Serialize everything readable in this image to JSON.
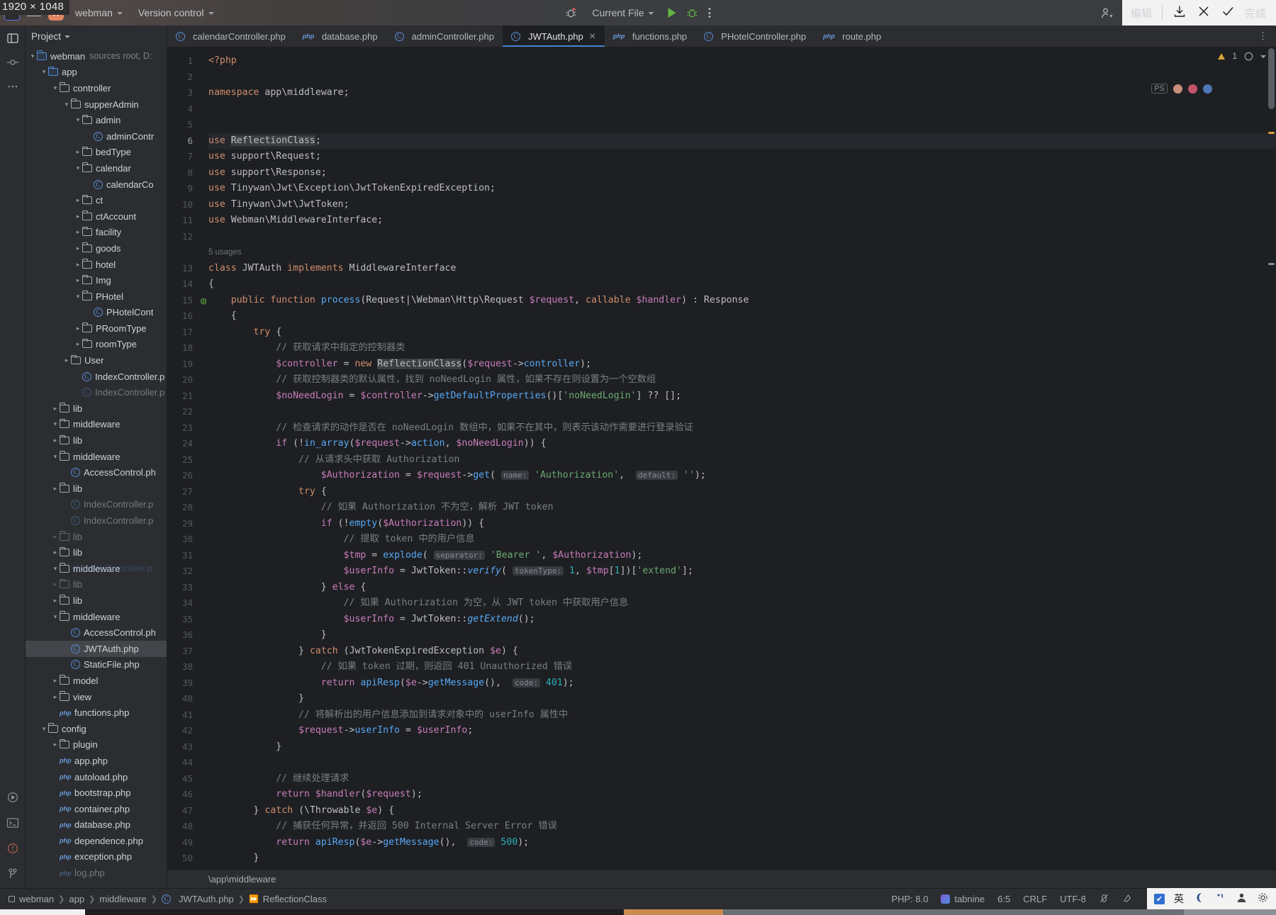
{
  "overlay": {
    "dimension_badge": "1920 × 1048",
    "screenshot_tool": {
      "edit_label": "编辑",
      "save_icon": "download-icon",
      "close_icon": "close-icon",
      "done_label": "完成"
    }
  },
  "titlebar": {
    "ps_icon": "phpstorm-icon",
    "menu_icon": "hamburger-menu-icon",
    "project_badge": "W",
    "project_name": "webman",
    "version_control": "Version control",
    "debug_error_icon": "debug-error-icon",
    "run_config": "Current File",
    "run_icon": "run-icon",
    "debug_icon": "debug-icon",
    "more_icon": "more-options-icon",
    "share_icon": "add-user-icon",
    "search_icon": "search-icon",
    "settings_icon": "gear-icon"
  },
  "rail": {
    "top": [
      {
        "name": "project-tool-icon",
        "glyph": "▣"
      },
      {
        "name": "commit-tool-icon",
        "glyph": "⎇"
      },
      {
        "name": "more-tool-icon",
        "glyph": "⋯"
      }
    ],
    "right": [
      {
        "name": "notifications-icon",
        "glyph": "🔔"
      },
      {
        "name": "ai-assistant-icon",
        "glyph": "✳"
      },
      {
        "name": "database-icon",
        "glyph": "⛁"
      },
      {
        "name": "gradle-icon",
        "glyph": "✿"
      },
      {
        "name": "plugin-icon",
        "glyph": "✡"
      }
    ],
    "bottom": [
      {
        "name": "run-tool-icon",
        "glyph": "▷"
      },
      {
        "name": "terminal-icon",
        "glyph": "⌨"
      },
      {
        "name": "problems-icon",
        "glyph": "⚠"
      },
      {
        "name": "vcs-branch-icon",
        "glyph": "⑂"
      }
    ]
  },
  "project_panel": {
    "title": "Project",
    "tree": [
      {
        "depth": 0,
        "arrow": "down",
        "icon": "folder-blue",
        "label": "webman",
        "suffix": "sources root, D:"
      },
      {
        "depth": 1,
        "arrow": "down",
        "icon": "folder-blue",
        "label": "app"
      },
      {
        "depth": 2,
        "arrow": "down",
        "icon": "folder",
        "label": "controller"
      },
      {
        "depth": 3,
        "arrow": "down",
        "icon": "folder",
        "label": "supperAdmin"
      },
      {
        "depth": 4,
        "arrow": "down",
        "icon": "folder",
        "label": "admin"
      },
      {
        "depth": 5,
        "arrow": "none",
        "icon": "class",
        "label": "adminContr"
      },
      {
        "depth": 4,
        "arrow": "right",
        "icon": "folder",
        "label": "bedType"
      },
      {
        "depth": 4,
        "arrow": "down",
        "icon": "folder",
        "label": "calendar"
      },
      {
        "depth": 5,
        "arrow": "none",
        "icon": "class",
        "label": "calendarCo"
      },
      {
        "depth": 4,
        "arrow": "right",
        "icon": "folder",
        "label": "ct"
      },
      {
        "depth": 4,
        "arrow": "right",
        "icon": "folder",
        "label": "ctAccount"
      },
      {
        "depth": 4,
        "arrow": "right",
        "icon": "folder",
        "label": "facility"
      },
      {
        "depth": 4,
        "arrow": "right",
        "icon": "folder",
        "label": "goods"
      },
      {
        "depth": 4,
        "arrow": "right",
        "icon": "folder",
        "label": "hotel"
      },
      {
        "depth": 4,
        "arrow": "right",
        "icon": "folder",
        "label": "Img"
      },
      {
        "depth": 4,
        "arrow": "down",
        "icon": "folder",
        "label": "PHotel"
      },
      {
        "depth": 5,
        "arrow": "none",
        "icon": "class",
        "label": "PHotelCont"
      },
      {
        "depth": 4,
        "arrow": "right",
        "icon": "folder",
        "label": "PRoomType"
      },
      {
        "depth": 4,
        "arrow": "right",
        "icon": "folder",
        "label": "roomType"
      },
      {
        "depth": 3,
        "arrow": "right",
        "icon": "folder",
        "label": "User"
      },
      {
        "depth": 4,
        "arrow": "none",
        "icon": "class",
        "label": "IndexController.p"
      },
      {
        "depth": 4,
        "arrow": "none",
        "icon": "class",
        "label": "IndexController.p",
        "ghost": true
      },
      {
        "depth": 2,
        "arrow": "right",
        "icon": "folder",
        "label": "lib"
      },
      {
        "depth": 2,
        "arrow": "down",
        "icon": "folder",
        "label": "middleware"
      },
      {
        "depth": 2,
        "arrow": "right",
        "icon": "folder",
        "label": "lib"
      },
      {
        "depth": 2,
        "arrow": "down",
        "icon": "folder",
        "label": "middleware"
      },
      {
        "depth": 3,
        "arrow": "none",
        "icon": "class",
        "label": "AccessControl.ph"
      },
      {
        "depth": 2,
        "arrow": "right",
        "icon": "folder",
        "label": "lib"
      },
      {
        "depth": 3,
        "arrow": "none",
        "icon": "class",
        "label": "IndexController.p",
        "ghost": true
      },
      {
        "depth": 3,
        "arrow": "none",
        "icon": "class",
        "label": "IndexController.p",
        "ghost": true
      },
      {
        "depth": 2,
        "arrow": "right",
        "icon": "folder",
        "label": "lib",
        "ghost": true
      },
      {
        "depth": 2,
        "arrow": "right",
        "icon": "folder",
        "label": "lib"
      },
      {
        "depth": 2,
        "arrow": "down",
        "icon": "folder",
        "label": "middleware",
        "ghostOverlay": "IndexController.p"
      },
      {
        "depth": 2,
        "arrow": "right",
        "icon": "folder",
        "label": "lib",
        "ghost": true
      },
      {
        "depth": 2,
        "arrow": "right",
        "icon": "folder",
        "label": "lib"
      },
      {
        "depth": 2,
        "arrow": "down",
        "icon": "folder",
        "label": "middleware"
      },
      {
        "depth": 3,
        "arrow": "none",
        "icon": "class",
        "label": "AccessControl.ph"
      },
      {
        "depth": 3,
        "arrow": "none",
        "icon": "class",
        "label": "JWTAuth.php",
        "selected": true
      },
      {
        "depth": 3,
        "arrow": "none",
        "icon": "class",
        "label": "StaticFile.php"
      },
      {
        "depth": 2,
        "arrow": "right",
        "icon": "folder",
        "label": "model"
      },
      {
        "depth": 2,
        "arrow": "right",
        "icon": "folder",
        "label": "view"
      },
      {
        "depth": 2,
        "arrow": "none",
        "icon": "php",
        "label": "functions.php"
      },
      {
        "depth": 1,
        "arrow": "down",
        "icon": "folder",
        "label": "config"
      },
      {
        "depth": 2,
        "arrow": "right",
        "icon": "folder",
        "label": "plugin"
      },
      {
        "depth": 2,
        "arrow": "none",
        "icon": "php",
        "label": "app.php"
      },
      {
        "depth": 2,
        "arrow": "none",
        "icon": "php",
        "label": "autoload.php"
      },
      {
        "depth": 2,
        "arrow": "none",
        "icon": "php",
        "label": "bootstrap.php"
      },
      {
        "depth": 2,
        "arrow": "none",
        "icon": "php",
        "label": "container.php"
      },
      {
        "depth": 2,
        "arrow": "none",
        "icon": "php",
        "label": "database.php"
      },
      {
        "depth": 2,
        "arrow": "none",
        "icon": "php",
        "label": "dependence.php"
      },
      {
        "depth": 2,
        "arrow": "none",
        "icon": "php",
        "label": "exception.php"
      },
      {
        "depth": 2,
        "arrow": "none",
        "icon": "php",
        "label": "log.php",
        "ghost": true
      }
    ]
  },
  "tabs": [
    {
      "label": "calendarController.php",
      "icon": "class",
      "active": false
    },
    {
      "label": "database.php",
      "icon": "php",
      "active": false
    },
    {
      "label": "adminController.php",
      "icon": "class",
      "active": false
    },
    {
      "label": "JWTAuth.php",
      "icon": "class",
      "active": true,
      "closable": true
    },
    {
      "label": "functions.php",
      "icon": "php",
      "active": false
    },
    {
      "label": "PHotelController.php",
      "icon": "class",
      "active": false
    },
    {
      "label": "route.php",
      "icon": "php",
      "active": false
    }
  ],
  "editor": {
    "warning_count": "1",
    "inspection_icon": "inspection-widget-icon",
    "file_path_hint": "\\app\\middleware",
    "usages_hint": "5 usages",
    "lines": [
      {
        "n": 1,
        "html": "<span class=\"kw\">&lt;?php</span>"
      },
      {
        "n": 2,
        "html": ""
      },
      {
        "n": 3,
        "html": "<span class=\"kw\">namespace</span> <span class=\"cls\">app\\middleware</span><span class=\"punc\">;</span>"
      },
      {
        "n": 4,
        "html": ""
      },
      {
        "n": 5,
        "html": ""
      },
      {
        "n": 6,
        "html": "<span class=\"kw\">use</span> <span class=\"hl-sym\">ReflectionClass</span><span class=\"punc\">;</span>",
        "current": true
      },
      {
        "n": 7,
        "html": "<span class=\"kw\">use</span> <span class=\"cls\">support\\Request</span><span class=\"punc\">;</span>"
      },
      {
        "n": 8,
        "html": "<span class=\"kw\">use</span> <span class=\"cls\">support\\Response</span><span class=\"punc\">;</span>"
      },
      {
        "n": 9,
        "html": "<span class=\"kw\">use</span> <span class=\"cls\">Tinywan\\Jwt\\Exception\\JwtTokenExpiredException</span><span class=\"punc\">;</span>"
      },
      {
        "n": 10,
        "html": "<span class=\"kw\">use</span> <span class=\"cls\">Tinywan\\Jwt\\JwtToken</span><span class=\"punc\">;</span>"
      },
      {
        "n": 11,
        "html": "<span class=\"kw\">use</span> <span class=\"cls\">Webman\\MiddlewareInterface</span><span class=\"punc\">;</span>"
      },
      {
        "n": 12,
        "html": ""
      },
      {
        "n": "",
        "html": "<span class=\"usages\">5 usages</span>",
        "usages": true
      },
      {
        "n": 13,
        "html": "<span class=\"kw\">class</span> <span class=\"cls\">JWTAuth</span> <span class=\"kw\">implements</span> <span class=\"cls\">MiddlewareInterface</span>"
      },
      {
        "n": 14,
        "html": "<span class=\"punc\">{</span>"
      },
      {
        "n": 15,
        "html": "    <span class=\"kw\">public function</span> <span class=\"fn\">process</span><span class=\"punc\">(</span><span class=\"cls\">Request|\\Webman\\Http\\Request</span> <span class=\"var\">$request</span><span class=\"punc\">,</span> <span class=\"kw\">callable</span> <span class=\"var\">$handler</span><span class=\"punc\">)</span> <span class=\"punc\">:</span> <span class=\"cls\">Response</span>",
        "gutter_mark": "override"
      },
      {
        "n": 16,
        "html": "    <span class=\"punc\">{</span>"
      },
      {
        "n": 17,
        "html": "        <span class=\"kw\">try</span> <span class=\"punc\">{</span>"
      },
      {
        "n": 18,
        "html": "            <span class=\"cmt\">// 获取请求中指定的控制器类</span>"
      },
      {
        "n": 19,
        "html": "            <span class=\"var\">$controller</span> <span class=\"punc\">=</span> <span class=\"kw\">new</span> <span class=\"hl-sym\">ReflectionClass</span><span class=\"punc\">(</span><span class=\"var\">$request</span><span class=\"punc\">-&gt;</span><span class=\"fn\">controller</span><span class=\"punc\">);</span>"
      },
      {
        "n": 20,
        "html": "            <span class=\"cmt\">// 获取控制器类的默认属性，找到 noNeedLogin 属性，如果不存在则设置为一个空数组</span>"
      },
      {
        "n": 21,
        "html": "            <span class=\"var\">$noNeedLogin</span> <span class=\"punc\">=</span> <span class=\"var\">$controller</span><span class=\"punc\">-&gt;</span><span class=\"fn\">getDefaultProperties</span><span class=\"punc\">()[</span><span class=\"str\">'noNeedLogin'</span><span class=\"punc\">] ?? [];</span>"
      },
      {
        "n": 22,
        "html": ""
      },
      {
        "n": 23,
        "html": "            <span class=\"cmt\">// 检查请求的动作是否在 noNeedLogin 数组中，如果不在其中，则表示该动作需要进行登录验证</span>"
      },
      {
        "n": 24,
        "html": "            <span class=\"kw2\">if</span> <span class=\"punc\">(!</span><span class=\"fn\">in_array</span><span class=\"punc\">(</span><span class=\"var\">$request</span><span class=\"punc\">-&gt;</span><span class=\"fn\">action</span><span class=\"punc\">,</span> <span class=\"var\">$noNeedLogin</span><span class=\"punc\">)) {</span>"
      },
      {
        "n": 25,
        "html": "                <span class=\"cmt\">// 从请求头中获取 Authorization</span>"
      },
      {
        "n": 26,
        "html": "                    <span class=\"var\">$Authorization</span> <span class=\"punc\">=</span> <span class=\"var\">$request</span><span class=\"punc\">-&gt;</span><span class=\"fn\">get</span><span class=\"punc\">(</span> <span class=\"hint\">name:</span> <span class=\"str\">'Authorization'</span><span class=\"punc\">,</span>  <span class=\"hint\">default:</span> <span class=\"str\">''</span><span class=\"punc\">);</span>"
      },
      {
        "n": 27,
        "html": "                <span class=\"kw\">try</span> <span class=\"punc\">{</span>"
      },
      {
        "n": 28,
        "html": "                    <span class=\"cmt\">// 如果 Authorization 不为空，解析 JWT token</span>"
      },
      {
        "n": 29,
        "html": "                    <span class=\"kw2\">if</span> <span class=\"punc\">(!</span><span class=\"fn\">empty</span><span class=\"punc\">(</span><span class=\"var\">$Authorization</span><span class=\"punc\">)) {</span>"
      },
      {
        "n": 30,
        "html": "                        <span class=\"cmt\">// 提取 token 中的用户信息</span>"
      },
      {
        "n": 31,
        "html": "                        <span class=\"var\">$tmp</span> <span class=\"punc\">=</span> <span class=\"fn\">explode</span><span class=\"punc\">(</span> <span class=\"hint\">separator:</span> <span class=\"str\">'Bearer '</span><span class=\"punc\">,</span> <span class=\"var\">$Authorization</span><span class=\"punc\">);</span>"
      },
      {
        "n": 32,
        "html": "                        <span class=\"var\">$userInfo</span> <span class=\"punc\">=</span> <span class=\"cls\">JwtToken</span><span class=\"punc\">::</span><span class=\"fni\">verify</span><span class=\"punc\">(</span> <span class=\"hint\">tokenType:</span> <span class=\"num\">1</span><span class=\"punc\">,</span> <span class=\"var\">$tmp</span><span class=\"punc\">[</span><span class=\"num\">1</span><span class=\"punc\">])[</span><span class=\"str\">'extend'</span><span class=\"punc\">];</span>"
      },
      {
        "n": 33,
        "html": "                    <span class=\"punc\">}</span> <span class=\"kw2\">else</span> <span class=\"punc\">{</span>"
      },
      {
        "n": 34,
        "html": "                        <span class=\"cmt\">// 如果 Authorization 为空，从 JWT token 中获取用户信息</span>"
      },
      {
        "n": 35,
        "html": "                        <span class=\"var\">$userInfo</span> <span class=\"punc\">=</span> <span class=\"cls\">JwtToken</span><span class=\"punc\">::</span><span class=\"fni\">getExtend</span><span class=\"punc\">();</span>"
      },
      {
        "n": 36,
        "html": "                    <span class=\"punc\">}</span>"
      },
      {
        "n": 37,
        "html": "                <span class=\"punc\">}</span> <span class=\"kw\">catch</span> <span class=\"punc\">(</span><span class=\"cls\">JwtTokenExpiredException</span> <span class=\"var\">$e</span><span class=\"punc\">) {</span>"
      },
      {
        "n": 38,
        "html": "                    <span class=\"cmt\">// 如果 token 过期，则返回 401 Unauthorized 错误</span>"
      },
      {
        "n": 39,
        "html": "                    <span class=\"kw2\">return</span> <span class=\"fn\">apiResp</span><span class=\"punc\">(</span><span class=\"var\">$e</span><span class=\"punc\">-&gt;</span><span class=\"fn\">getMessage</span><span class=\"punc\">(),</span>  <span class=\"hint\">code:</span> <span class=\"num\">401</span><span class=\"punc\">);</span>"
      },
      {
        "n": 40,
        "html": "                <span class=\"punc\">}</span>"
      },
      {
        "n": 41,
        "html": "                <span class=\"cmt\">// 将解析出的用户信息添加到请求对象中的 userInfo 属性中</span>"
      },
      {
        "n": 42,
        "html": "                <span class=\"var\">$request</span><span class=\"punc\">-&gt;</span><span class=\"fn\">userInfo</span> <span class=\"punc\">=</span> <span class=\"var\">$userInfo</span><span class=\"punc\">;</span>"
      },
      {
        "n": 43,
        "html": "            <span class=\"punc\">}</span>"
      },
      {
        "n": 44,
        "html": ""
      },
      {
        "n": 45,
        "html": "            <span class=\"cmt\">// 继续处理请求</span>"
      },
      {
        "n": 46,
        "html": "            <span class=\"kw2\">return</span> <span class=\"var\">$handler</span><span class=\"punc\">(</span><span class=\"var\">$request</span><span class=\"punc\">);</span>"
      },
      {
        "n": 47,
        "html": "        <span class=\"punc\">}</span> <span class=\"kw\">catch</span> <span class=\"punc\">(</span><span class=\"cls\">\\Throwable</span> <span class=\"var\">$e</span><span class=\"punc\">) {</span>"
      },
      {
        "n": 48,
        "html": "            <span class=\"cmt\">// 捕获任何异常，并返回 500 Internal Server Error 错误</span>"
      },
      {
        "n": 49,
        "html": "            <span class=\"kw2\">return</span> <span class=\"fn\">apiResp</span><span class=\"punc\">(</span><span class=\"var\">$e</span><span class=\"punc\">-&gt;</span><span class=\"fn\">getMessage</span><span class=\"punc\">(),</span>  <span class=\"hint\">code:</span> <span class=\"num\">500</span><span class=\"punc\">);</span>"
      },
      {
        "n": 50,
        "html": "        <span class=\"punc\">}</span>"
      },
      {
        "n": 51,
        "html": "    <span class=\"punc\">}</span>"
      },
      {
        "n": 52,
        "html": ""
      },
      {
        "n": 53,
        "html": "<span class=\"punc\">}</span>"
      }
    ]
  },
  "breadcrumb": [
    {
      "label": "webman",
      "icon": "module-icon"
    },
    {
      "label": "app",
      "icon": "none"
    },
    {
      "label": "middleware",
      "icon": "none"
    },
    {
      "label": "JWTAuth.php",
      "icon": "class"
    },
    {
      "label": "ReflectionClass",
      "icon": "symbol-icon"
    }
  ],
  "status": {
    "php_version": "PHP: 8.0",
    "tabnine": "tabnine",
    "caret": "6:5",
    "line_ending": "CRLF",
    "encoding": "UTF-8",
    "lock_icon": "no-read-only-icon",
    "inspection_icon": "inspection-level-icon"
  },
  "ime": {
    "chip": "✔",
    "lang": "英",
    "moon_icon": "moon-icon",
    "punct_icon": "punctuation-icon",
    "user_icon": "user-icon",
    "gear_icon": "gear-icon"
  }
}
